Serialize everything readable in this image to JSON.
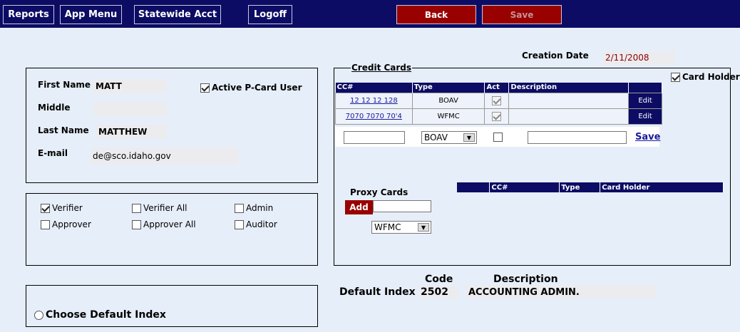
{
  "nav": {
    "reports": "Reports",
    "app_menu": "App Menu",
    "statewide": "Statewide Acct",
    "logoff": "Logoff",
    "back": "Back",
    "save": "Save"
  },
  "user": {
    "first_name_label": "First Name",
    "first_name": "MATT",
    "middle_label": "Middle",
    "middle": "",
    "last_name_label": "Last Name",
    "last_name": "MATTHEW",
    "email_label": "E-mail",
    "email": "de@sco.idaho.gov",
    "active_label": "Active P-Card User",
    "active_checked": true
  },
  "roles": {
    "verifier": "Verifier",
    "verifier_all": "Verifier All",
    "admin": "Admin",
    "approver": "Approver",
    "approver_all": "Approver All",
    "auditor": "Auditor"
  },
  "default_index": {
    "choose_label": "Choose Default Index",
    "label": "Default Index",
    "code_header": "Code",
    "desc_header": "Description",
    "code": "2502",
    "description": "ACCOUNTING ADMIN."
  },
  "creation": {
    "label": "Creation Date",
    "value": "2/11/2008"
  },
  "credit_cards": {
    "title": "Credit Cards",
    "card_holder_label": "Card Holder",
    "headers": [
      "CC#",
      "Type",
      "Act",
      "Description"
    ],
    "rows": [
      {
        "cc": "12 12 12 128",
        "type": "BOAV",
        "act": true,
        "description": "",
        "edit": "Edit"
      },
      {
        "cc": "7070 7070 70'4",
        "type": "WFMC",
        "act": true,
        "description": "",
        "edit": "Edit"
      }
    ],
    "new_type": "BOAV",
    "save_link": "Save"
  },
  "proxy_cards": {
    "title": "Proxy Cards",
    "add": "Add",
    "select": "WFMC",
    "headers": [
      "CC#",
      "Type",
      "Card Holder"
    ]
  },
  "colors": {
    "navy": "#0c0c64",
    "red_button": "#990000",
    "date_text": "#8b0000",
    "background": "#e6eef9"
  }
}
